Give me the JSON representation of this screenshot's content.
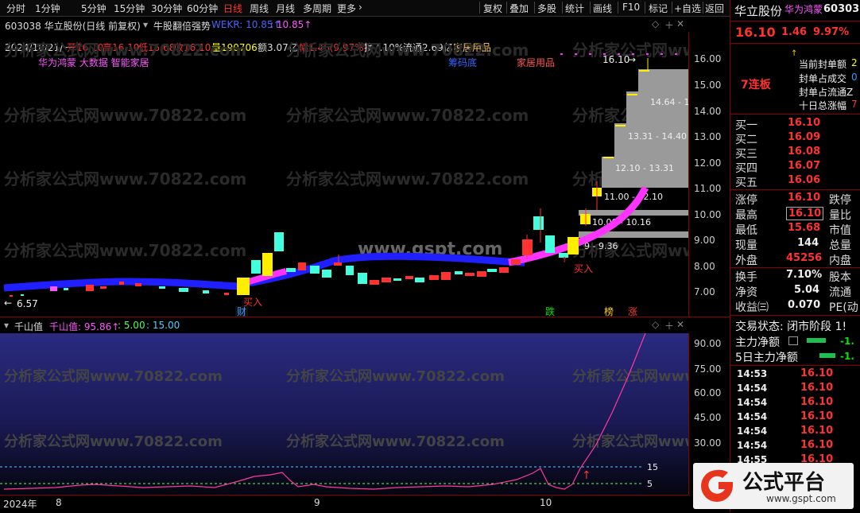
{
  "toolbar": {
    "items": [
      "分时",
      "1分钟",
      "5分钟",
      "15分钟",
      "30分钟",
      "60分钟",
      "日线",
      "周线",
      "月线",
      "多周期",
      "更多"
    ],
    "right_items": [
      "复权",
      "叠加",
      "多股",
      "统计",
      "画线",
      "F10",
      "标记",
      "+自选",
      "返回"
    ],
    "active": "日线"
  },
  "header": {
    "stock_title": "603038 华立股份(日线 前复权)",
    "indicator_name": "牛股翻倍强势",
    "wekr": "WEKR: 10.85↑",
    "wekr2": ": 10.85↑"
  },
  "ohlc": {
    "date": "2024/10/21/一",
    "open": "开16.10",
    "high": "高16.10",
    "low": "低15.68",
    "close": "收16.10",
    "volume": "量190706",
    "amount": "额3.07亿",
    "change": "幅1.46(9.97%)",
    "turnover": "换7.10%",
    "float": "流通2.69亿",
    "sector": "家居用品"
  },
  "chart_labels": {
    "concepts": "华为鸿蒙 大数据 智能家居",
    "chip": "筹码底",
    "sector_label": "家居用品",
    "high_label": "16.10",
    "low_label": "6.57",
    "buy1": "买入",
    "buy2": "买入",
    "tag_cai": "财",
    "tag_die": "跌",
    "tag_bang": "榜",
    "tag_zhang": "涨",
    "zones": [
      "14.64 - 15.6",
      "13.31 - 14.40",
      "12.10 - 13.31",
      "11.00 - 12.10",
      "10.00 - 10.16",
      "9 - 9.36"
    ],
    "watermark1": "分析家公式网www.70822.com",
    "watermark2": "www.gspt.com"
  },
  "price_axis": [
    "16.00",
    "15.00",
    "14.00",
    "13.00",
    "12.00",
    "11.00",
    "10.00",
    "9.00",
    "8.00",
    "7.00"
  ],
  "sub": {
    "title": "千山值",
    "value": "千山值: 95.86↑",
    "l5": ": 5.00",
    "l15": ": 15.00",
    "axis": [
      "90.00",
      "75.00",
      "60.00",
      "45.00",
      "30.00"
    ],
    "line15": "15",
    "line5": "5"
  },
  "date_axis": {
    "year": "2024年",
    "m8": "8",
    "m9": "9",
    "m10": "10"
  },
  "right": {
    "name": "华立股份",
    "concept": "华为鸿蒙",
    "code": "603038",
    "price": "16.10",
    "chg": "1.46",
    "pct": "9.97%",
    "streak": "7连板",
    "seal_items": [
      "当前封单额",
      "封单占成交",
      "封单占流通Z",
      "十日总涨幅"
    ],
    "seal_vals": [
      "2",
      "0",
      "",
      "7"
    ],
    "bids": [
      {
        "k": "买一",
        "v": "16.10"
      },
      {
        "k": "买二",
        "v": "16.09"
      },
      {
        "k": "买三",
        "v": "16.08"
      },
      {
        "k": "买四",
        "v": "16.07"
      },
      {
        "k": "买五",
        "v": "16.06"
      }
    ],
    "stats_left": [
      {
        "k": "涨停",
        "v": "16.10",
        "c": "red"
      },
      {
        "k": "最高",
        "v": "16.10",
        "c": "red"
      },
      {
        "k": "最低",
        "v": "15.68",
        "c": "red"
      },
      {
        "k": "现量",
        "v": "144",
        "c": "white"
      },
      {
        "k": "外盘",
        "v": "45256",
        "c": "red"
      }
    ],
    "stats_right": [
      "跌停",
      "量比",
      "市值",
      "总量",
      "内盘"
    ],
    "stats2": [
      {
        "k": "换手",
        "v": "7.10%",
        "c": "white"
      },
      {
        "k": "净资",
        "v": "5.04",
        "c": "white"
      },
      {
        "k": "收益㈢",
        "v": "0.070",
        "c": "white"
      }
    ],
    "stats2_right": [
      "股本",
      "流通",
      "PE(动"
    ],
    "trade_state": "交易状态: 闭市阶段 1!",
    "main_net": "主力净额",
    "main_net_v": "-1.",
    "main_net5": "5日主力净额",
    "main_net5_v": "-1.",
    "ticks": [
      {
        "t": "14:53",
        "p": "16.10"
      },
      {
        "t": "14:54",
        "p": "16.10"
      },
      {
        "t": "14:54",
        "p": "16.10"
      },
      {
        "t": "14:54",
        "p": "16.10"
      },
      {
        "t": "14:54",
        "p": "16.10"
      },
      {
        "t": "14:54",
        "p": "16.10"
      },
      {
        "t": "14:55",
        "p": "16.10"
      }
    ]
  },
  "badge": {
    "title": "公式平台",
    "url": "www.gspt.com"
  }
}
